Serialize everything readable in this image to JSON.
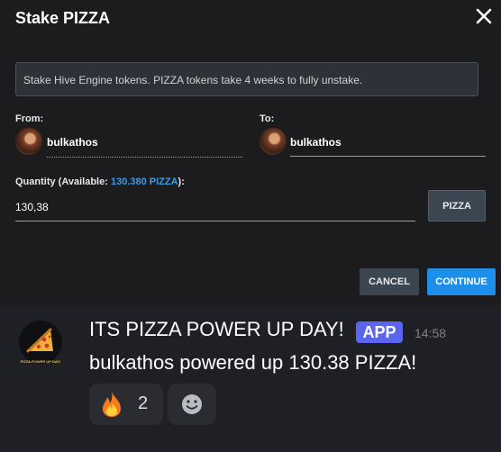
{
  "dialog": {
    "title": "Stake PIZZA",
    "info_text": "Stake Hive Engine tokens. PIZZA tokens take 4 weeks to fully unstake.",
    "from_label": "From:",
    "from_user": "bulkathos",
    "to_label": "To:",
    "to_user": "bulkathos",
    "quantity_label_prefix": "Quantity (Available: ",
    "quantity_available": "130.380 PIZZA",
    "quantity_label_suffix": "):",
    "quantity_value": "130,38",
    "token_button": "PIZZA",
    "cancel_label": "CANCEL",
    "continue_label": "CONTINUE"
  },
  "chat": {
    "avatar_text": "PIZZA POWER UP DAY!",
    "title": "ITS PIZZA POWER UP DAY!",
    "badge": "APP",
    "time": "14:58",
    "body": "bulkathos powered up 130.38 PIZZA!",
    "reaction_count": "2"
  },
  "icons": {
    "close": "close-icon",
    "fire": "fire-icon",
    "add_reaction": "smile-icon",
    "pizza": "pizza-icon"
  },
  "colors": {
    "accent": "#1e8fe8",
    "available_text": "#3c9ce3",
    "app_badge": "#5a66f0"
  }
}
